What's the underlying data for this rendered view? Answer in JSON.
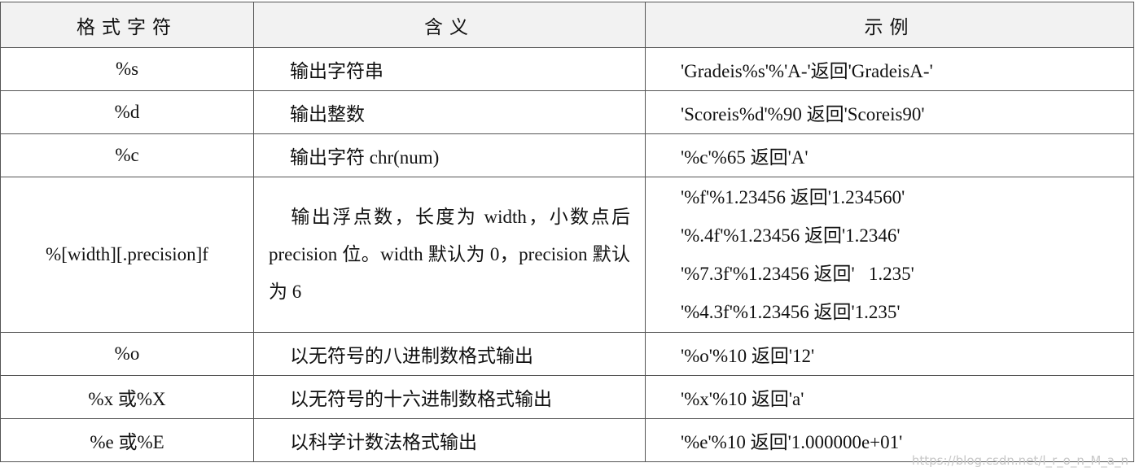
{
  "table": {
    "headers": {
      "format": "格式字符",
      "meaning": "含义",
      "example": "示例"
    },
    "rows": [
      {
        "format": "%s",
        "meaning": "输出字符串",
        "examples": [
          "'Gradeis%s'%'A-'返回'GradeisA-'"
        ]
      },
      {
        "format": "%d",
        "meaning": "输出整数",
        "examples": [
          "'Scoreis%d'%90 返回'Scoreis90'"
        ]
      },
      {
        "format": "%c",
        "meaning": "输出字符 chr(num)",
        "examples": [
          "'%c'%65 返回'A'"
        ]
      },
      {
        "format": "%[width][.precision]f",
        "meaning": "输出浮点数，长度为 width，小数点后 precision 位。width 默认为 0，precision 默认为 6",
        "examples": [
          "'%f'%1.23456 返回'1.234560'",
          "'%.4f'%1.23456 返回'1.2346'",
          "'%7.3f'%1.23456 返回'   1.235'",
          "'%4.3f'%1.23456 返回'1.235'"
        ]
      },
      {
        "format": "%o",
        "meaning": "以无符号的八进制数格式输出",
        "examples": [
          "'%o'%10 返回'12'"
        ]
      },
      {
        "format": "%x 或%X",
        "meaning": "以无符号的十六进制数格式输出",
        "examples": [
          "'%x'%10 返回'a'"
        ]
      },
      {
        "format": "%e 或%E",
        "meaning": "以科学计数法格式输出",
        "examples": [
          "'%e'%10 返回'1.000000e+01'"
        ]
      }
    ]
  },
  "watermark": "https://blog.csdn.net/l_r_o_n_M_a_n"
}
